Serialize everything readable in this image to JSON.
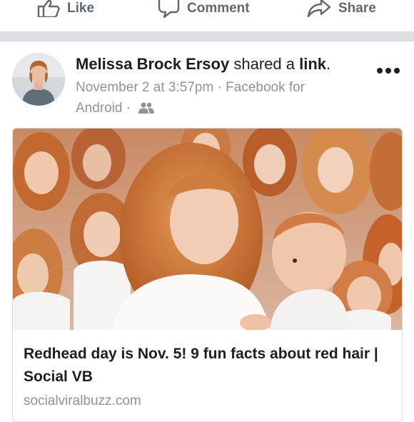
{
  "actions": {
    "like_label": "Like",
    "comment_label": "Comment",
    "share_label": "Share",
    "icons": [
      "thumbs-up-icon",
      "comment-bubble-icon",
      "share-arrow-icon"
    ]
  },
  "post": {
    "author": "Melissa Brock Ersoy",
    "action_text": "shared a",
    "link_word": "link",
    "timestamp": "November 2 at 3:57pm",
    "separator": "·",
    "source": "Facebook for Android",
    "audience_icon": "friends-icon",
    "more_icon": "more-options-icon"
  },
  "link_card": {
    "title": "Redhead day is Nov. 5! 9 fun facts about red hair | Social VB",
    "domain": "socialviralbuzz.com",
    "image_icon": "photo-redheads-woman-baby"
  },
  "colors": {
    "action_gray": "#606770",
    "meta_gray": "#8d949e",
    "divider": "#dadde1",
    "text": "#1c1e21"
  }
}
